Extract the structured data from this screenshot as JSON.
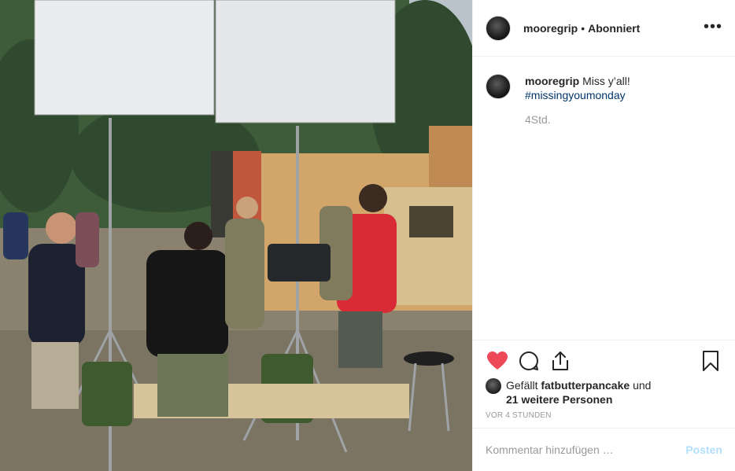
{
  "header": {
    "username": "mooregrip",
    "separator": "•",
    "follow_state": "Abonniert",
    "more_icon": "more-horizontal-icon"
  },
  "caption": {
    "username": "mooregrip",
    "text": "Miss y’all!",
    "hashtag": "#missingyoumonday",
    "time": "4Std."
  },
  "actions": {
    "like_icon": "heart-filled-icon",
    "comment_icon": "comment-icon",
    "share_icon": "share-icon",
    "save_icon": "bookmark-icon",
    "like_color": "#ed4956"
  },
  "likes": {
    "prefix": "Gefällt",
    "user": "fatbutterpancake",
    "suffix": "und",
    "others": "21 weitere Personen"
  },
  "timestamp": "VOR 4 STUNDEN",
  "comment_input": {
    "placeholder": "Kommentar hinzufügen …",
    "post_label": "Posten"
  }
}
